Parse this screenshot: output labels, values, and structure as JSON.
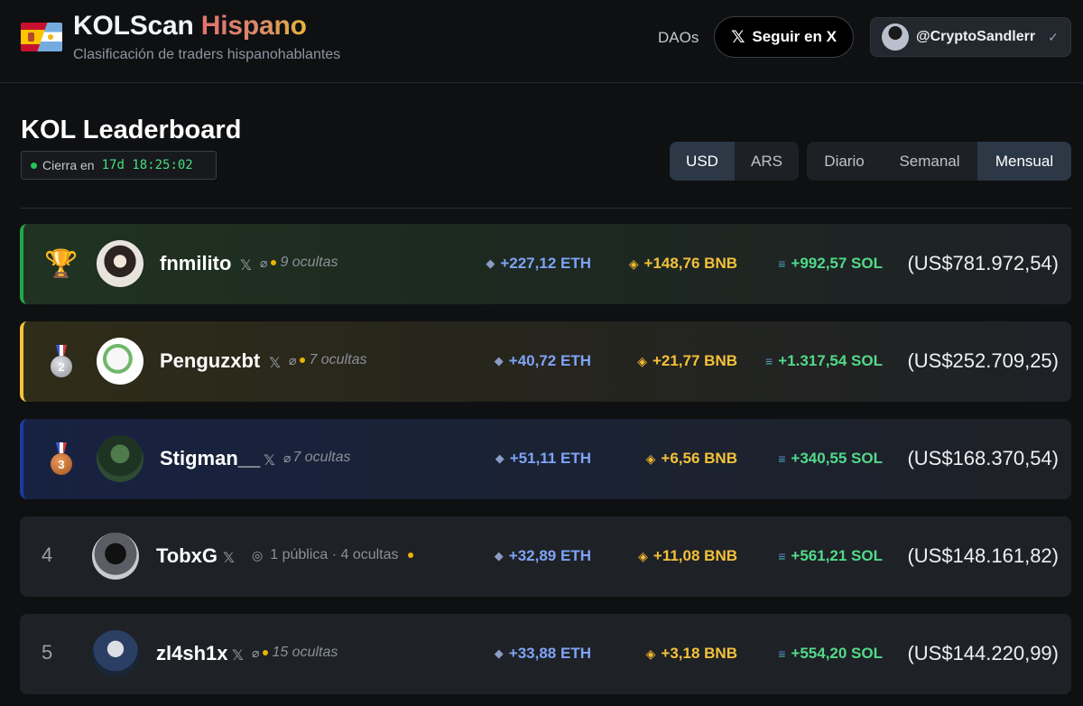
{
  "header": {
    "brand_main": "KOLScan",
    "brand_accent": "Hispano",
    "subtitle": "Clasificación de traders hispanohablantes",
    "nav_daos": "DAOs",
    "follow_label": "Seguir en X",
    "follow_icon": "x-logo-icon",
    "user_handle": "@CryptoSandlerr",
    "user_check_icon": "check-icon"
  },
  "board": {
    "title": "KOL Leaderboard",
    "timer_label": "Cierra en",
    "timer_value": "17d 18:25:02",
    "currency_options": [
      "USD",
      "ARS"
    ],
    "currency_selected": "USD",
    "period_options": [
      "Diario",
      "Semanal",
      "Mensual"
    ],
    "period_selected": "Mensual"
  },
  "colors": {
    "gold_border": "#22a84a",
    "silver_border": "#f2c53b",
    "bronze_border": "#1d3a9e",
    "eth": "#7fa3f5",
    "bnb": "#f3c13a",
    "sol": "#52d98a"
  },
  "rows": [
    {
      "rank": "1",
      "rank_icon": "trophy-icon",
      "name": "fnmilito",
      "x_icon": "𝕏",
      "visibility": "9 ocultas",
      "eth": "+227,12 ETH",
      "bnb": "+148,76 BNB",
      "sol": "+992,57 SOL",
      "usd": "(US$781.972,54)"
    },
    {
      "rank": "2",
      "rank_icon": "silver-medal-icon",
      "name": "Penguzxbt",
      "x_icon": "𝕏",
      "visibility": "7 ocultas",
      "eth": "+40,72 ETH",
      "bnb": "+21,77 BNB",
      "sol": "+1.317,54 SOL",
      "usd": "(US$252.709,25)"
    },
    {
      "rank": "3",
      "rank_icon": "bronze-medal-icon",
      "name": "Stigman__",
      "x_icon": "𝕏",
      "visibility": "7 ocultas",
      "eth": "+51,11 ETH",
      "bnb": "+6,56 BNB",
      "sol": "+340,55 SOL",
      "usd": "(US$168.370,54)"
    },
    {
      "rank": "4",
      "name": "TobxG",
      "x_icon": "𝕏",
      "visibility": "1 pública · 4 ocultas",
      "eth": "+32,89 ETH",
      "bnb": "+11,08 BNB",
      "sol": "+561,21 SOL",
      "usd": "(US$148.161,82)"
    },
    {
      "rank": "5",
      "name": "zl4sh1x",
      "x_icon": "𝕏",
      "visibility": "15 ocultas",
      "eth": "+33,88 ETH",
      "bnb": "+3,18 BNB",
      "sol": "+554,20 SOL",
      "usd": "(US$144.220,99)"
    }
  ]
}
